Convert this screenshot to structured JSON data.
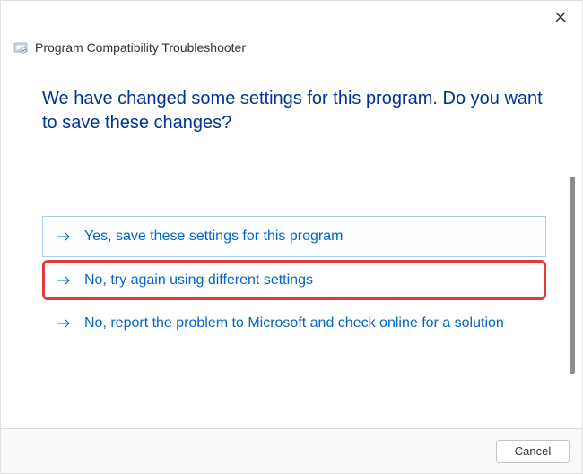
{
  "header": {
    "title": "Program Compatibility Troubleshooter"
  },
  "main": {
    "heading": "We have changed some settings for this program. Do you want to save these changes?",
    "options": [
      {
        "label": "Yes, save these settings for this program"
      },
      {
        "label": "No, try again using different settings"
      },
      {
        "label": "No, report the problem to Microsoft and check online for a solution"
      }
    ]
  },
  "footer": {
    "cancel_label": "Cancel"
  }
}
